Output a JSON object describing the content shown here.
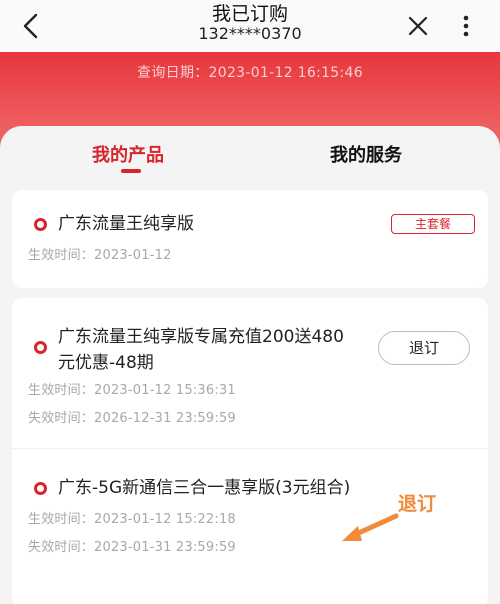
{
  "header": {
    "title": "我已订购",
    "phone": "132****0370"
  },
  "query": {
    "label": "查询日期：",
    "datetime": "2023-01-12 16:15:46"
  },
  "tabs": [
    {
      "label": "我的产品",
      "active": true
    },
    {
      "label": "我的服务",
      "active": false
    }
  ],
  "products": [
    {
      "name": "广东流量王纯享版",
      "badge": "主套餐",
      "effective_label": "生效时间：",
      "effective": "2023-01-12"
    },
    {
      "name_line1": "广东流量王纯享版专属充值200送480",
      "name_line2": "元优惠-48期",
      "button": "退订",
      "effective_label": "生效时间：",
      "effective": "2023-01-12 15:36:31",
      "expire_label": "失效时间：",
      "expire": "2026-12-31 23:59:59"
    },
    {
      "name": "广东-5G新通信三合一惠享版(3元组合)",
      "effective_label": "生效时间：",
      "effective": "2023-01-12 15:22:18",
      "expire_label": "失效时间：",
      "expire": "2023-01-31 23:59:59"
    }
  ],
  "annotation": {
    "text": "退订"
  },
  "colors": {
    "brand_red": "#d8242b",
    "hero_red": "#e6363c",
    "annotation_orange": "#f28a3a"
  }
}
